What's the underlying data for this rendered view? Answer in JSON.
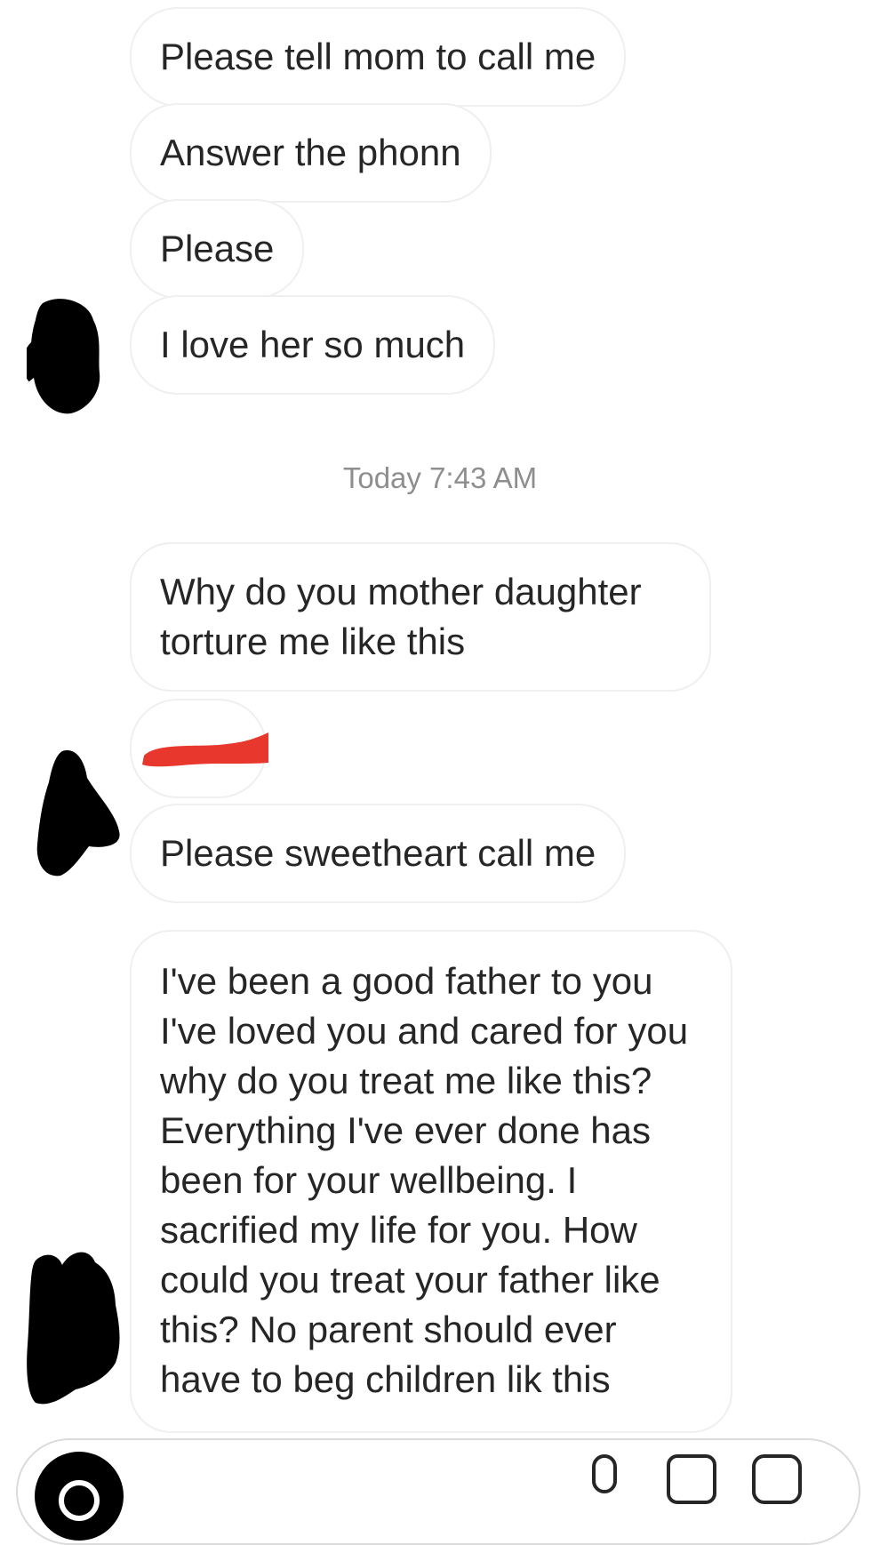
{
  "conversation": {
    "messages_before": [
      {
        "text": "Please tell mom to call me"
      },
      {
        "text": "Answer the phonn"
      },
      {
        "text": "Please"
      },
      {
        "text": "I love her so much"
      }
    ],
    "timestamp": "Today 7:43 AM",
    "messages_after": [
      {
        "text": "Why do you mother daughter torture me like this"
      },
      {
        "text": "",
        "redacted": true
      },
      {
        "text": "Please sweetheart call me"
      },
      {
        "text": "I've been a good father to you I've loved you and cared for you why do you treat me like this? Everything I've ever done has been for your wellbeing. I sacrified my life for you. How could you treat your father like this? No parent should ever have to beg children lik this"
      }
    ]
  },
  "composer": {
    "icons": [
      "camera-icon",
      "microphone-icon",
      "gallery-icon",
      "sticker-icon"
    ]
  },
  "colors": {
    "bubble_border": "#efefef",
    "timestamp": "#8e8e8e",
    "redaction_red": "#e8372c",
    "redaction_black": "#000000"
  }
}
